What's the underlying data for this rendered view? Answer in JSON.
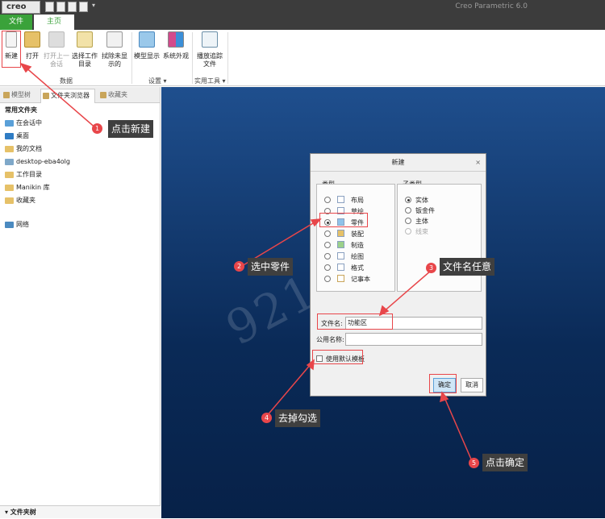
{
  "app": {
    "logo": "creo",
    "title": "Creo Parametric 6.0"
  },
  "tabs": {
    "file": "文件",
    "home": "主页"
  },
  "ribbon": {
    "new": "新建",
    "open": "打开",
    "open_prev": "打开上一会话",
    "select_dir": "选择工作目录",
    "erase": "拭除未显示的",
    "model_display": "模型显示",
    "sys_appearance": "系统外观",
    "play_trail": "播放追踪文件",
    "group_data": "数据",
    "group_settings": "设置 ▾",
    "group_tools": "实用工具 ▾"
  },
  "left_panel": {
    "tabs": [
      "模型树",
      "文件夹浏览器",
      "收藏夹"
    ],
    "section": "常用文件夹",
    "items": [
      "在会话中",
      "桌面",
      "我的文档",
      "desktop-eba4olg",
      "工作目录",
      "Manikin 库",
      "收藏夹"
    ],
    "network": "网络",
    "footer": "▾ 文件夹树"
  },
  "dialog": {
    "title": "新建",
    "type_label": "类型",
    "types": [
      "布局",
      "草绘",
      "零件",
      "装配",
      "制造",
      "绘图",
      "格式",
      "记事本"
    ],
    "selected_type": "零件",
    "subtype_label": "子类型",
    "subtypes": [
      "实体",
      "钣金件",
      "主体",
      "线束"
    ],
    "selected_subtype": "实体",
    "filename_label": "文件名:",
    "filename_value": "功能区",
    "common_name_label": "公用名称:",
    "common_name_value": "",
    "use_template": "使用默认模板",
    "ok": "确定",
    "cancel": "取消"
  },
  "annotations": [
    {
      "num": "1",
      "text": "点击新建"
    },
    {
      "num": "2",
      "text": "选中零件"
    },
    {
      "num": "3",
      "text": "文件名任意"
    },
    {
      "num": "4",
      "text": "去掉勾选"
    },
    {
      "num": "5",
      "text": "点击确定"
    }
  ],
  "watermark": "921 亚桐",
  "colors": {
    "accent_green": "#3aa23a",
    "highlight_red": "#e8464a",
    "canvas_blue": "#0a2a57"
  }
}
